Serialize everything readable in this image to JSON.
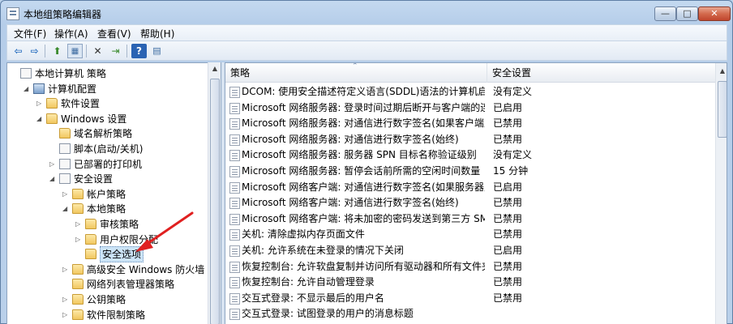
{
  "window": {
    "title": "本地组策略编辑器",
    "controls": {
      "minimize": "—",
      "maximize": "□",
      "close": "✕"
    }
  },
  "menu": [
    "文件(F)",
    "操作(A)",
    "查看(V)",
    "帮助(H)"
  ],
  "toolbar": {
    "icons": [
      "back-arrow-icon",
      "forward-arrow-icon",
      "up-folder-icon",
      "show-tree-icon",
      "delete-icon",
      "export-icon",
      "help-icon",
      "properties-icon"
    ]
  },
  "tree": {
    "items": [
      {
        "label": "本地计算机 策略",
        "level": 0,
        "icon": "policy",
        "expand": ""
      },
      {
        "label": "计算机配置",
        "level": 1,
        "icon": "computer",
        "expand": "◢"
      },
      {
        "label": "软件设置",
        "level": 2,
        "icon": "folder",
        "expand": "▷"
      },
      {
        "label": "Windows 设置",
        "level": 2,
        "icon": "folder",
        "expand": "◢"
      },
      {
        "label": "域名解析策略",
        "level": 3,
        "icon": "folder",
        "expand": ""
      },
      {
        "label": "脚本(启动/关机)",
        "level": 3,
        "icon": "policy",
        "expand": ""
      },
      {
        "label": "已部署的打印机",
        "level": 3,
        "icon": "policy",
        "expand": "▷"
      },
      {
        "label": "安全设置",
        "level": 3,
        "icon": "policy",
        "expand": "◢"
      },
      {
        "label": "帐户策略",
        "level": 4,
        "icon": "folder",
        "expand": "▷"
      },
      {
        "label": "本地策略",
        "level": 4,
        "icon": "folder",
        "expand": "◢"
      },
      {
        "label": "审核策略",
        "level": 5,
        "icon": "folder",
        "expand": "▷"
      },
      {
        "label": "用户权限分配",
        "level": 5,
        "icon": "folder",
        "expand": "▷"
      },
      {
        "label": "安全选项",
        "level": 5,
        "icon": "folder",
        "expand": "",
        "selected": true
      },
      {
        "label": "高级安全 Windows 防火墙",
        "level": 4,
        "icon": "folder",
        "expand": "▷"
      },
      {
        "label": "网络列表管理器策略",
        "level": 4,
        "icon": "folder",
        "expand": ""
      },
      {
        "label": "公钥策略",
        "level": 4,
        "icon": "folder",
        "expand": "▷"
      },
      {
        "label": "软件限制策略",
        "level": 4,
        "icon": "folder",
        "expand": "▷"
      }
    ]
  },
  "list": {
    "columns": {
      "policy": "策略",
      "setting": "安全设置"
    },
    "rows": [
      {
        "policy": "DCOM: 使用安全描述符定义语言(SDDL)语法的计算机启动...",
        "setting": "没有定义"
      },
      {
        "policy": "Microsoft 网络服务器: 登录时间过期后断开与客户端的连接",
        "setting": "已启用"
      },
      {
        "policy": "Microsoft 网络服务器: 对通信进行数字签名(如果客户端允...",
        "setting": "已禁用"
      },
      {
        "policy": "Microsoft 网络服务器: 对通信进行数字签名(始终)",
        "setting": "已禁用"
      },
      {
        "policy": "Microsoft 网络服务器: 服务器 SPN 目标名称验证级别",
        "setting": "没有定义"
      },
      {
        "policy": "Microsoft 网络服务器: 暂停会话前所需的空闲时间数量",
        "setting": "15 分钟"
      },
      {
        "policy": "Microsoft 网络客户端: 对通信进行数字签名(如果服务器允...",
        "setting": "已启用"
      },
      {
        "policy": "Microsoft 网络客户端: 对通信进行数字签名(始终)",
        "setting": "已禁用"
      },
      {
        "policy": "Microsoft 网络客户端: 将未加密的密码发送到第三方 SMB...",
        "setting": "已禁用"
      },
      {
        "policy": "关机: 清除虚拟内存页面文件",
        "setting": "已禁用"
      },
      {
        "policy": "关机: 允许系统在未登录的情况下关闭",
        "setting": "已启用"
      },
      {
        "policy": "恢复控制台: 允许软盘复制并访问所有驱动器和所有文件夹",
        "setting": "已禁用"
      },
      {
        "policy": "恢复控制台: 允许自动管理登录",
        "setting": "已禁用"
      },
      {
        "policy": "交互式登录: 不显示最后的用户名",
        "setting": "已禁用"
      },
      {
        "policy": "交互式登录: 试图登录的用户的消息标题",
        "setting": ""
      }
    ]
  }
}
